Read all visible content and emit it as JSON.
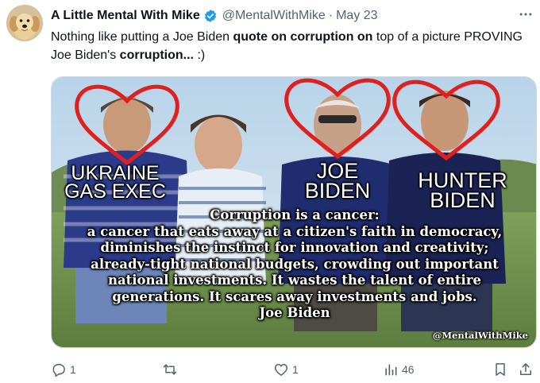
{
  "tweet": {
    "display_name": "A Little Mental With Mike",
    "handle": "@MentalWithMike",
    "separator": "·",
    "date": "May 23",
    "text_parts": [
      "Nothing like putting a Joe Biden ",
      "quote on corruption on",
      " top of a picture PROVING Joe Biden's ",
      "corruption...",
      " :)"
    ]
  },
  "media": {
    "labels": {
      "ukraine_line1": "UKRAINE",
      "ukraine_line2": "GAS EXEC",
      "joe_line1": "JOE",
      "joe_line2": "BIDEN",
      "hunter_line1": "HUNTER",
      "hunter_line2": "BIDEN"
    },
    "quote_lines": [
      "Corruption is a cancer:",
      "a cancer that eats away at a citizen's faith in democracy,",
      "diminishes the instinct for innovation and creativity;",
      "already-tight national budgets, crowding out important",
      "national investments. It wastes the talent of entire",
      "generations. It scares away investments and jobs.",
      "Joe Biden"
    ],
    "watermark": "@MentalWithMike",
    "heart_color": "#e0201e"
  },
  "actions": {
    "reply_count": "1",
    "retweet_count": "",
    "like_count": "1",
    "views_count": "46"
  },
  "icons": {
    "verified": "verified-badge-icon",
    "more": "more-icon",
    "reply": "reply-icon",
    "retweet": "retweet-icon",
    "like": "like-icon",
    "views": "views-icon",
    "bookmark": "bookmark-icon",
    "share": "share-icon"
  },
  "colors": {
    "verified_blue": "#1d9bf0",
    "secondary_text": "#536471"
  }
}
